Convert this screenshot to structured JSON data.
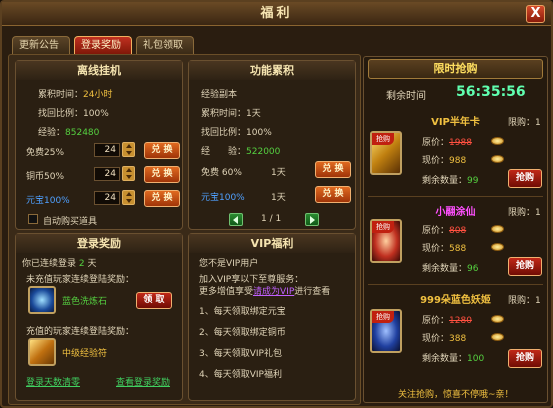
{
  "window": {
    "title": "福利",
    "close": "X"
  },
  "tabs": [
    "更新公告",
    "登录奖励",
    "礼包领取"
  ],
  "offline": {
    "title": "离线挂机",
    "time_label": "累积时间：",
    "time_value": "24小时",
    "ratio_label": "找回比例：",
    "ratio_value": "100%",
    "exp_label": "经验：",
    "exp_value": "852480",
    "rows": [
      {
        "label": "免费25%",
        "value": "24",
        "btn": "兑 换"
      },
      {
        "label": "铜币50%",
        "value": "24",
        "btn": "兑 换"
      },
      {
        "label": "元宝100%",
        "value": "24",
        "btn": "兑 换"
      }
    ],
    "auto_buy": "自动购买道具"
  },
  "func": {
    "title": "功能累积",
    "sub": "经验副本",
    "time_label": "累积时间：",
    "time_value": "1天",
    "ratio_label": "找回比例：",
    "ratio_value": "100%",
    "exp_label": "经　　验：",
    "exp_value": "522000",
    "rows": [
      {
        "label": "免费 60%",
        "days": "1天",
        "btn": "兑 换"
      },
      {
        "label": "元宝100%",
        "days": "1天",
        "btn": "兑 换"
      }
    ],
    "page": "1 / 1"
  },
  "login": {
    "title": "登录奖励",
    "consec_pre": "你已连续登录",
    "consec_num": "2",
    "consec_post": "天",
    "noncharge": "未充值玩家连续登陆奖励：",
    "item1": "蓝色洗炼石",
    "claim": "领 取",
    "charge": "充值的玩家连续登陆奖励：",
    "item2": "中级经验符",
    "link1": "登录天数清零",
    "link2": "查看登录奖励"
  },
  "vip": {
    "title": "VIP福利",
    "status": "您不是VIP用户",
    "line1": "加入VIP享以下至尊服务：",
    "line2_pre": "更多增值享受",
    "line2_link": "请成为VIP",
    "line2_post": "进行查看",
    "perks": [
      "1、每天领取绑定元宝",
      "2、每天领取绑定铜币",
      "3、每天领取VIP礼包",
      "4、每天领取VIP福利"
    ]
  },
  "flash": {
    "title": "限时抢购",
    "remain_label": "剩余时间",
    "timer": "56:35:56",
    "badge": "抢购",
    "items": [
      {
        "name": "VIP半年卡",
        "limit": "限购：1",
        "orig_label": "原价：",
        "orig": "1988",
        "now_label": "现价：",
        "now": "988",
        "left_label": "剩余数量：",
        "left": "99",
        "btn": "抢购"
      },
      {
        "name": "小翮涂仙",
        "limit": "限购：1",
        "orig_label": "原价：",
        "orig": "808",
        "now_label": "现价：",
        "now": "588",
        "left_label": "剩余数量：",
        "left": "96",
        "btn": "抢购"
      },
      {
        "name": "999朵蓝色妖姬",
        "limit": "限购：1",
        "orig_label": "原价：",
        "orig": "1280",
        "now_label": "现价：",
        "now": "388",
        "left_label": "剩余数量：",
        "left": "100",
        "btn": "抢购"
      }
    ],
    "footer": "关注抢购，惊喜不停哦~亲！"
  }
}
